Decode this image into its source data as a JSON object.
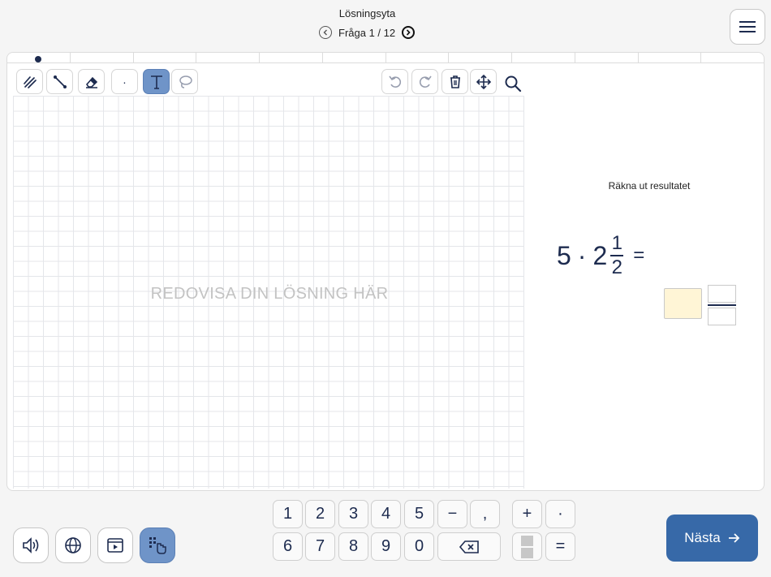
{
  "header": {
    "title": "Lösningsyta",
    "question_counter": "Fråga 1 / 12"
  },
  "progress": {
    "total_segments": 12,
    "current": 1
  },
  "drawing": {
    "placeholder": "REDOVISA DIN LÖSNING HÄR",
    "tools": [
      "pen-tool",
      "line-tool",
      "eraser-tool",
      "dot-tool",
      "text-tool",
      "lasso-tool",
      "undo",
      "redo",
      "delete",
      "move",
      "zoom"
    ],
    "active_tool": "text-tool",
    "dot_label": "·"
  },
  "question": {
    "instruction": "Räkna ut resultatet",
    "whole": "5",
    "operator": "·",
    "mixed_whole": "2",
    "frac_numerator": "1",
    "frac_denominator": "2",
    "equals": "="
  },
  "keypad": {
    "row1": [
      "1",
      "2",
      "3",
      "4",
      "5",
      "−",
      ","
    ],
    "row2": [
      "6",
      "7",
      "8",
      "9",
      "0"
    ],
    "ops_row1": [
      "+",
      "·"
    ],
    "ops_row2_equals": "="
  },
  "next_button": {
    "label": "Nästa"
  },
  "colors": {
    "accent": "#3769a8",
    "active_tool": "#6f94c8",
    "text": "#1d2b4f",
    "answer_box": "#fff5d6"
  }
}
